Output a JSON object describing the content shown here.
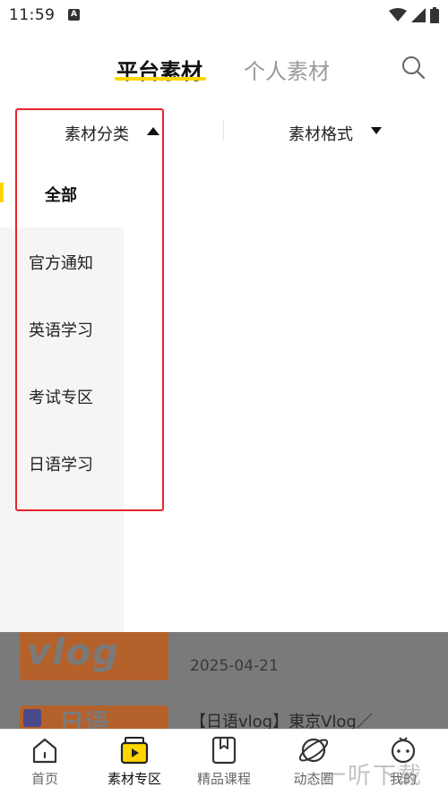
{
  "status": {
    "time": "11:59",
    "notif_letter": "A"
  },
  "header": {
    "tabs": [
      {
        "label": "平台素材",
        "active": true
      },
      {
        "label": "个人素材",
        "active": false
      }
    ],
    "search_icon": "search-icon"
  },
  "filters": {
    "category_label": "素材分类",
    "format_label": "素材格式"
  },
  "categories": [
    {
      "label": "全部",
      "selected": true
    },
    {
      "label": "官方通知"
    },
    {
      "label": "英语学习"
    },
    {
      "label": "考试专区"
    },
    {
      "label": "日语学习"
    }
  ],
  "content": {
    "items": [
      {
        "thumb_text": "vlog",
        "date": "2025-04-21"
      },
      {
        "thumb_text": "日语",
        "title": "【日语vlog】東京Vlog／"
      }
    ]
  },
  "nav": {
    "items": [
      {
        "label": "首页",
        "icon": "home-icon"
      },
      {
        "label": "素材专区",
        "icon": "material-icon",
        "active": true
      },
      {
        "label": "精品课程",
        "icon": "bookmark-icon"
      },
      {
        "label": "动态圈",
        "icon": "planet-icon"
      },
      {
        "label": "我的",
        "icon": "profile-icon"
      }
    ]
  },
  "watermark": "一听下载",
  "colors": {
    "accent": "#FFD600",
    "highlight_box": "#e8232d",
    "thumb": "#b5612b"
  }
}
